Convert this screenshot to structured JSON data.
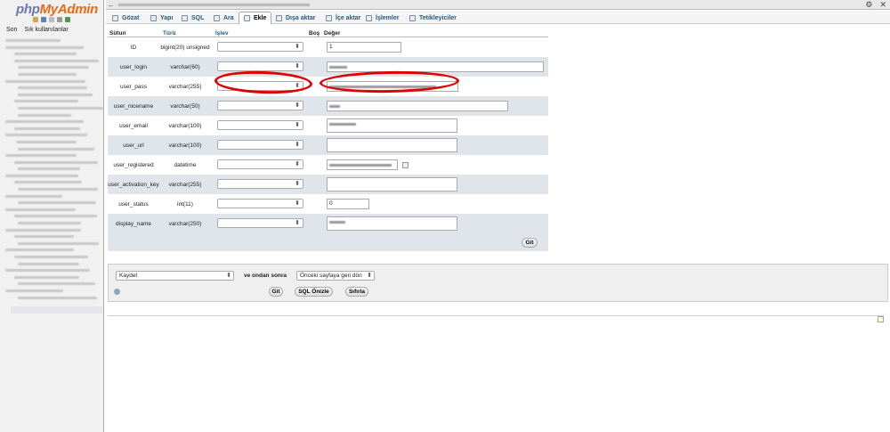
{
  "app": {
    "brand_php": "php",
    "brand_my": "My",
    "brand_admin": "Admin"
  },
  "nav": {
    "tabs": [
      "Son",
      "Sık kullanılanlar"
    ],
    "tree_item_count": 39
  },
  "topbar": {
    "back": "←",
    "window_controls": [
      "⚙",
      "✕"
    ]
  },
  "tabs": [
    {
      "label": "Gözat",
      "icon": "browse-icon"
    },
    {
      "label": "Yapı",
      "icon": "structure-icon"
    },
    {
      "label": "SQL",
      "icon": "sql-icon"
    },
    {
      "label": "Ara",
      "icon": "search-icon"
    },
    {
      "label": "Ekle",
      "icon": "insert-icon",
      "active": true
    },
    {
      "label": "Dışa aktar",
      "icon": "export-icon"
    },
    {
      "label": "İçe aktar",
      "icon": "import-icon"
    },
    {
      "label": "İşlemler",
      "icon": "operations-icon"
    },
    {
      "label": "Tetikleyiciler",
      "icon": "triggers-icon"
    }
  ],
  "table": {
    "headers": {
      "column": "Sütun",
      "type": "Türü",
      "function": "İşlev",
      "null": "Boş",
      "value": "Değer"
    },
    "rows": [
      {
        "name": "ID",
        "type": "bigint(20) unsigned",
        "value": "1",
        "field": "input"
      },
      {
        "name": "user_login",
        "type": "varchar(60)",
        "value": "",
        "field": "input"
      },
      {
        "name": "user_pass",
        "type": "varchar(255)",
        "value": "",
        "field": "input"
      },
      {
        "name": "user_nicename",
        "type": "varchar(50)",
        "value": "",
        "field": "input"
      },
      {
        "name": "user_email",
        "type": "varchar(100)",
        "value": "",
        "field": "textarea"
      },
      {
        "name": "user_url",
        "type": "varchar(100)",
        "value": "",
        "field": "textarea"
      },
      {
        "name": "user_registered",
        "type": "datetime",
        "value": "",
        "field": "input"
      },
      {
        "name": "user_activation_key",
        "type": "varchar(255)",
        "value": "",
        "field": "textarea"
      },
      {
        "name": "user_status",
        "type": "int(11)",
        "value": "0",
        "field": "input"
      },
      {
        "name": "display_name",
        "type": "varchar(250)",
        "value": "",
        "field": "textarea"
      }
    ],
    "go_label": "Git"
  },
  "bottom": {
    "save_select": "Kaydet",
    "then_label": "ve ondan sonra",
    "after_select": "Önceki sayfaya geri dön",
    "go": "Git",
    "preview_sql": "SQL Önizle",
    "reset": "Sıfırla"
  },
  "colors": {
    "row_even": "#dfe5ea",
    "link": "#235a81",
    "annotation": "#e00000",
    "brand_blue": "#6c78af",
    "brand_orange": "#e66a18"
  }
}
